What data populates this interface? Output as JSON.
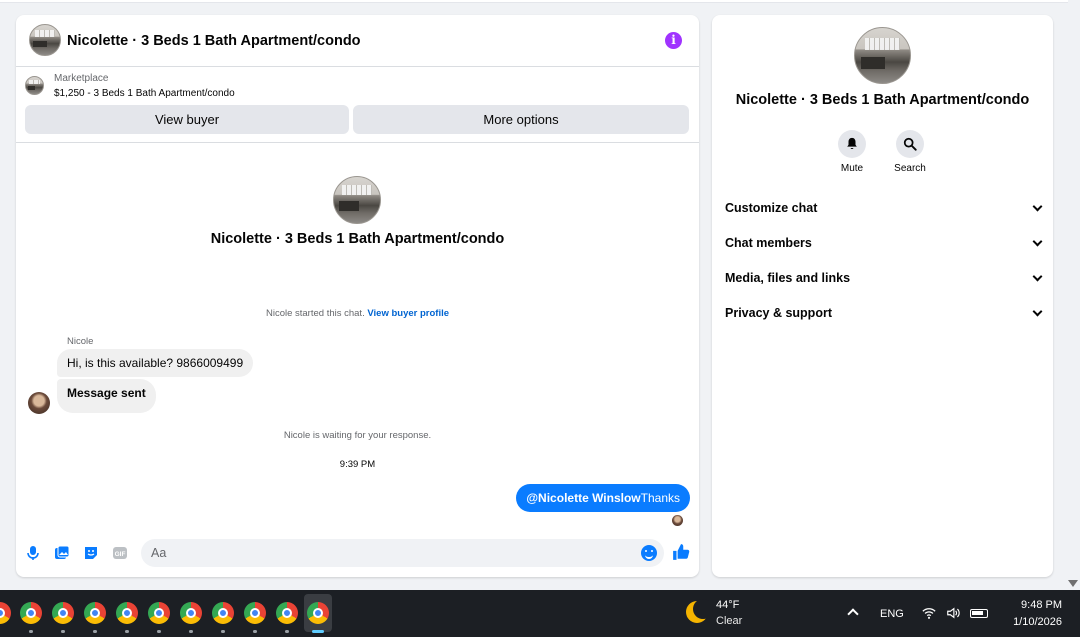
{
  "chat": {
    "header_title": "Nicolette · 3 Beds 1 Bath Apartment/condo",
    "marketplace_label": "Marketplace",
    "listing": "$1,250 - 3 Beds 1 Bath Apartment/condo",
    "view_buyer_label": "View buyer",
    "more_options_label": "More options",
    "center_title": "Nicolette · 3 Beds 1 Bath Apartment/condo",
    "started_text": "Nicole started this chat.",
    "view_profile_link": "View buyer profile",
    "sender_name": "Nicole",
    "messages_in": [
      "Hi, is this available? 9866009499",
      "Message sent"
    ],
    "waiting_text": "Nicole is waiting for your response.",
    "timestamp": "9:39 PM",
    "reply_mention": "@Nicolette Winslow",
    "reply_text": "Thanks",
    "input_placeholder": "Aa",
    "accent_color": "#0a7cff"
  },
  "side": {
    "title": "Nicolette · 3 Beds 1 Bath Apartment/condo",
    "actions": [
      "Mute",
      "Search"
    ],
    "menu": [
      "Customize chat",
      "Chat members",
      "Media, files and links",
      "Privacy & support"
    ]
  },
  "taskbar": {
    "temperature": "44°F",
    "condition": "Clear",
    "language": "ENG",
    "time": "9:48 PM",
    "date": "1/10/2026"
  }
}
